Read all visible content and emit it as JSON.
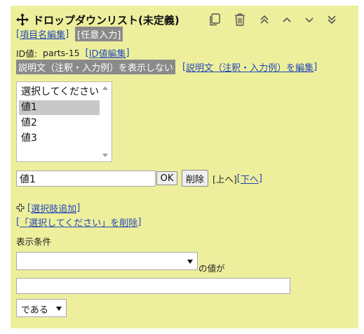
{
  "header": {
    "title": "ドロップダウンリスト(未定義)",
    "edit_label_link": "項目名編集",
    "optional_tag": "任意入力",
    "toolbar_icons": [
      "copy-icon",
      "trash-icon",
      "double-chevron-up-icon",
      "chevron-up-icon",
      "chevron-down-icon",
      "double-chevron-down-icon"
    ]
  },
  "id_row": {
    "label": "ID値:",
    "value": "parts-15",
    "edit_link": "ID値編集"
  },
  "description": {
    "hidden_tag": "説明文（注釈・入力例）を表示しない",
    "edit_link": "説明文（注釈・入力例）を編集"
  },
  "options_list": {
    "items": [
      "選択してください",
      "値1",
      "値2",
      "値3"
    ],
    "selected_index": 1
  },
  "edit_row": {
    "value": "値1",
    "ok_label": "OK",
    "delete_label": "削除",
    "up_text": "[上へ]",
    "down_link": "下へ"
  },
  "add_option": {
    "icon": "plus-icon",
    "link": "選択肢追加"
  },
  "remove_placeholder_link": "「選択してください」を削除",
  "display_condition": {
    "label": "表示条件",
    "field_select_value": "",
    "suffix": "の値が",
    "value_input": "",
    "operator_value": "である"
  }
}
